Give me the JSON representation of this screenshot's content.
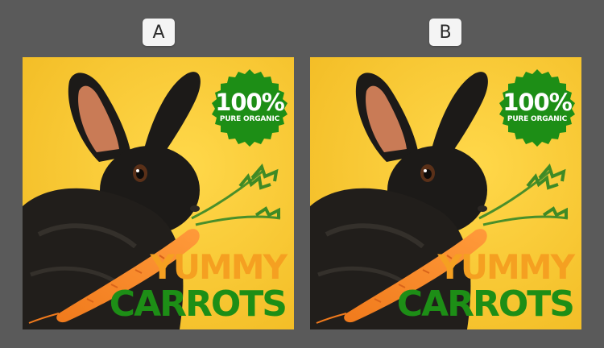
{
  "variants": [
    {
      "label": "A"
    },
    {
      "label": "B"
    }
  ],
  "ad": {
    "seal_line1": "100%",
    "seal_line2": "PURE ORGANIC",
    "headline_line1": "YUMMY",
    "headline_line2": "CARROTS"
  },
  "colors": {
    "background": "#5a5a5a",
    "poster_yellow": "#f9c82f",
    "seal_green": "#1d8e16",
    "headline_orange": "#f5a021",
    "headline_green": "#1d8e16",
    "carrot_orange": "#f57c22",
    "rabbit_black": "#1c1a18"
  }
}
